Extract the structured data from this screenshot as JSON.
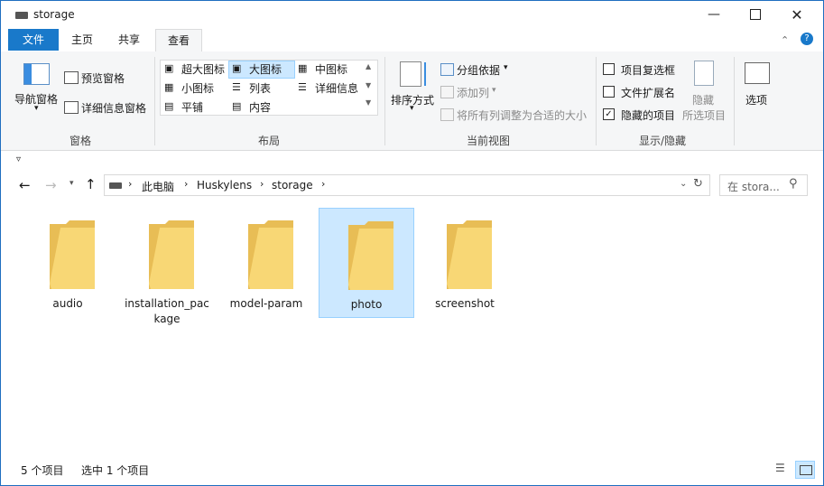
{
  "window": {
    "title": "storage"
  },
  "tabs": {
    "file": "文件",
    "home": "主页",
    "share": "共享",
    "view": "查看"
  },
  "ribbon": {
    "pane": {
      "nav_pane": "导航窗格",
      "preview_pane": "预览窗格",
      "details_pane": "详细信息窗格",
      "group": "窗格"
    },
    "layout": {
      "items": [
        "超大图标",
        "大图标",
        "中图标",
        "小图标",
        "列表",
        "详细信息",
        "平铺",
        "内容"
      ],
      "group": "布局"
    },
    "current_view": {
      "sort": "排序方式",
      "group_by": "分组依据",
      "add_column": "添加列",
      "fit_columns": "将所有列调整为合适的大小",
      "group": "当前视图"
    },
    "show_hide": {
      "item_checkbox": "项目复选框",
      "file_ext": "文件扩展名",
      "hidden_items": "隐藏的项目",
      "hide_selected_1": "隐藏",
      "hide_selected_2": "所选项目",
      "group": "显示/隐藏",
      "item_checkbox_checked": false,
      "file_ext_checked": false,
      "hidden_items_checked": true
    },
    "options": "选项"
  },
  "address": {
    "crumbs": [
      "此电脑",
      "Huskylens",
      "storage"
    ]
  },
  "search": {
    "placeholder": "在 stora..."
  },
  "folders": [
    {
      "name": "audio"
    },
    {
      "name": "installation_package_display",
      "line1": "installation_pac",
      "line2": "kage"
    },
    {
      "name": "model-param"
    },
    {
      "name": "photo"
    },
    {
      "name": "screenshot"
    }
  ],
  "status": {
    "count": "5 个项目",
    "selected": "选中 1 个项目"
  },
  "colors": {
    "accent": "#1979ca",
    "selection": "#cce8ff",
    "folder": "#f5d17a"
  }
}
